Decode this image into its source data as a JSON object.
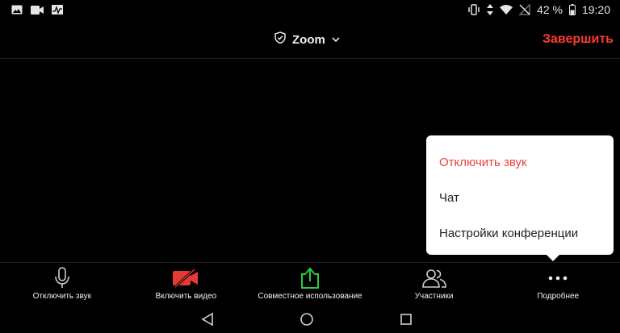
{
  "status_bar": {
    "battery_percent": "42 %",
    "time": "19:20",
    "left_icons": [
      "image-icon",
      "video-camera-icon",
      "activity-icon"
    ],
    "right_icons": [
      "vibrate-icon",
      "data-arrows-icon",
      "wifi-icon",
      "no-signal-icon",
      "battery-icon"
    ]
  },
  "header": {
    "title": "Zoom",
    "end_label": "Завершить",
    "accent_color": "#ff3b30"
  },
  "menu": {
    "items": [
      {
        "label": "Отключить звук",
        "color": "#e8423c"
      },
      {
        "label": "Чат"
      },
      {
        "label": "Настройки конференции"
      }
    ]
  },
  "toolbar": {
    "items": [
      {
        "label": "Отключить звук",
        "icon": "microphone-icon"
      },
      {
        "label": "Включить видео",
        "icon": "video-off-icon",
        "color": "#e53935"
      },
      {
        "label": "Совместное использование",
        "icon": "share-screen-icon",
        "color": "#2ecc40"
      },
      {
        "label": "Участники",
        "icon": "participants-icon"
      },
      {
        "label": "Подробнее",
        "icon": "more-icon"
      }
    ]
  },
  "nav_bar": {
    "icons": [
      "back-icon",
      "home-icon",
      "recents-icon"
    ]
  }
}
